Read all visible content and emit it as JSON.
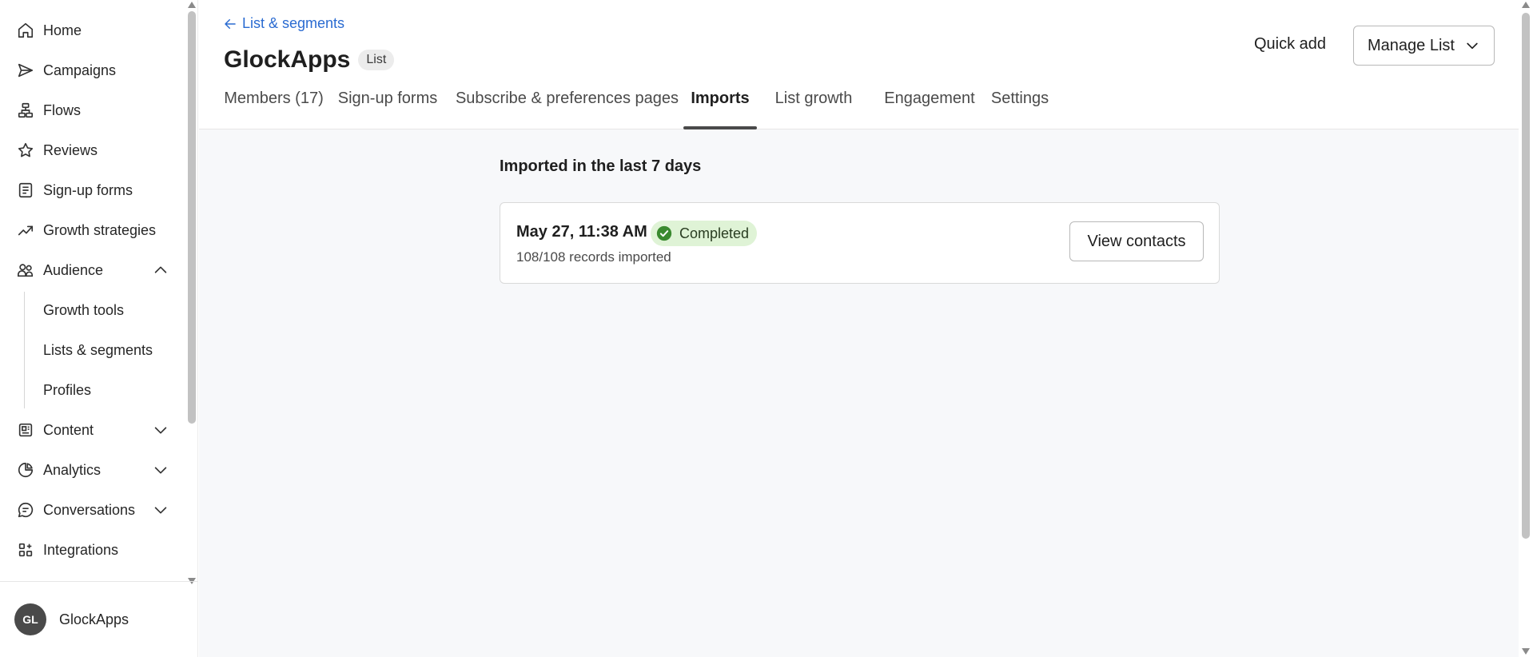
{
  "sidebar": {
    "items": [
      {
        "label": "Home",
        "icon": "home-icon"
      },
      {
        "label": "Campaigns",
        "icon": "send-icon"
      },
      {
        "label": "Flows",
        "icon": "flows-icon"
      },
      {
        "label": "Reviews",
        "icon": "star-icon"
      },
      {
        "label": "Sign-up forms",
        "icon": "form-icon"
      },
      {
        "label": "Growth strategies",
        "icon": "trend-icon"
      },
      {
        "label": "Audience",
        "icon": "audience-icon",
        "expanded": true
      },
      {
        "label": "Content",
        "icon": "content-icon"
      },
      {
        "label": "Analytics",
        "icon": "analytics-icon"
      },
      {
        "label": "Conversations",
        "icon": "chat-icon"
      },
      {
        "label": "Integrations",
        "icon": "integrations-icon"
      }
    ],
    "audience_sub": [
      {
        "label": "Growth tools"
      },
      {
        "label": "Lists & segments"
      },
      {
        "label": "Profiles"
      }
    ],
    "account": {
      "initials": "GL",
      "name": "GlockApps"
    }
  },
  "header": {
    "back_label": "List & segments",
    "title": "GlockApps",
    "badge": "List",
    "quick_add": "Quick add",
    "manage_list": "Manage List"
  },
  "tabs": [
    {
      "label": "Members (17)"
    },
    {
      "label": "Sign-up forms"
    },
    {
      "label": "Subscribe & preferences pages"
    },
    {
      "label": "Imports",
      "active": true
    },
    {
      "label": "List growth"
    },
    {
      "label": "Engagement"
    },
    {
      "label": "Settings"
    }
  ],
  "imports": {
    "section_title": "Imported in the last 7 days",
    "items": [
      {
        "date": "May 27, 11:38 AM",
        "status": "Completed",
        "records": "108/108 records imported",
        "action": "View contacts"
      }
    ]
  },
  "colors": {
    "link": "#2a6bd1",
    "status_bg": "#dff3d6",
    "status_icon": "#3a8a2f",
    "avatar_bg": "#4a4a4a"
  }
}
